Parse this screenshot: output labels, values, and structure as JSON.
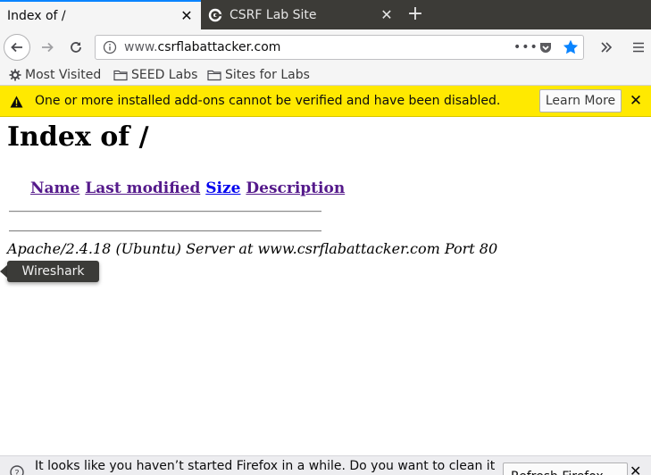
{
  "tabs": [
    {
      "title": "Index of /",
      "active": true
    },
    {
      "title": "CSRF Lab Site",
      "active": false
    }
  ],
  "url": {
    "prefix": "www.",
    "host": "csrflabattacker.com"
  },
  "bookmarks": [
    {
      "label": "Most Visited",
      "icon": "gear-icon"
    },
    {
      "label": "SEED Labs",
      "icon": "folder-icon"
    },
    {
      "label": "Sites for Labs",
      "icon": "folder-icon"
    }
  ],
  "notification": {
    "text": "One or more installed add-ons cannot be verified and have been disabled.",
    "button": "Learn More",
    "close": "✕"
  },
  "page": {
    "heading": "Index of /",
    "columns": [
      "Name",
      "Last modified",
      "Size",
      "Description"
    ],
    "server_signature": "Apache/2.4.18 (Ubuntu) Server at www.csrflabattacker.com Port 80"
  },
  "tooltip": "Wireshark",
  "bottom_notification": {
    "text": "It looks like you haven’t started Firefox in a while. Do you want to clean it",
    "button": "Refresh Firefox",
    "close": "✕"
  },
  "colors": {
    "accent": "#0a84ff",
    "notification_bg": "#ffe900",
    "visited_link": "#551a8b",
    "link": "#0000ee"
  }
}
